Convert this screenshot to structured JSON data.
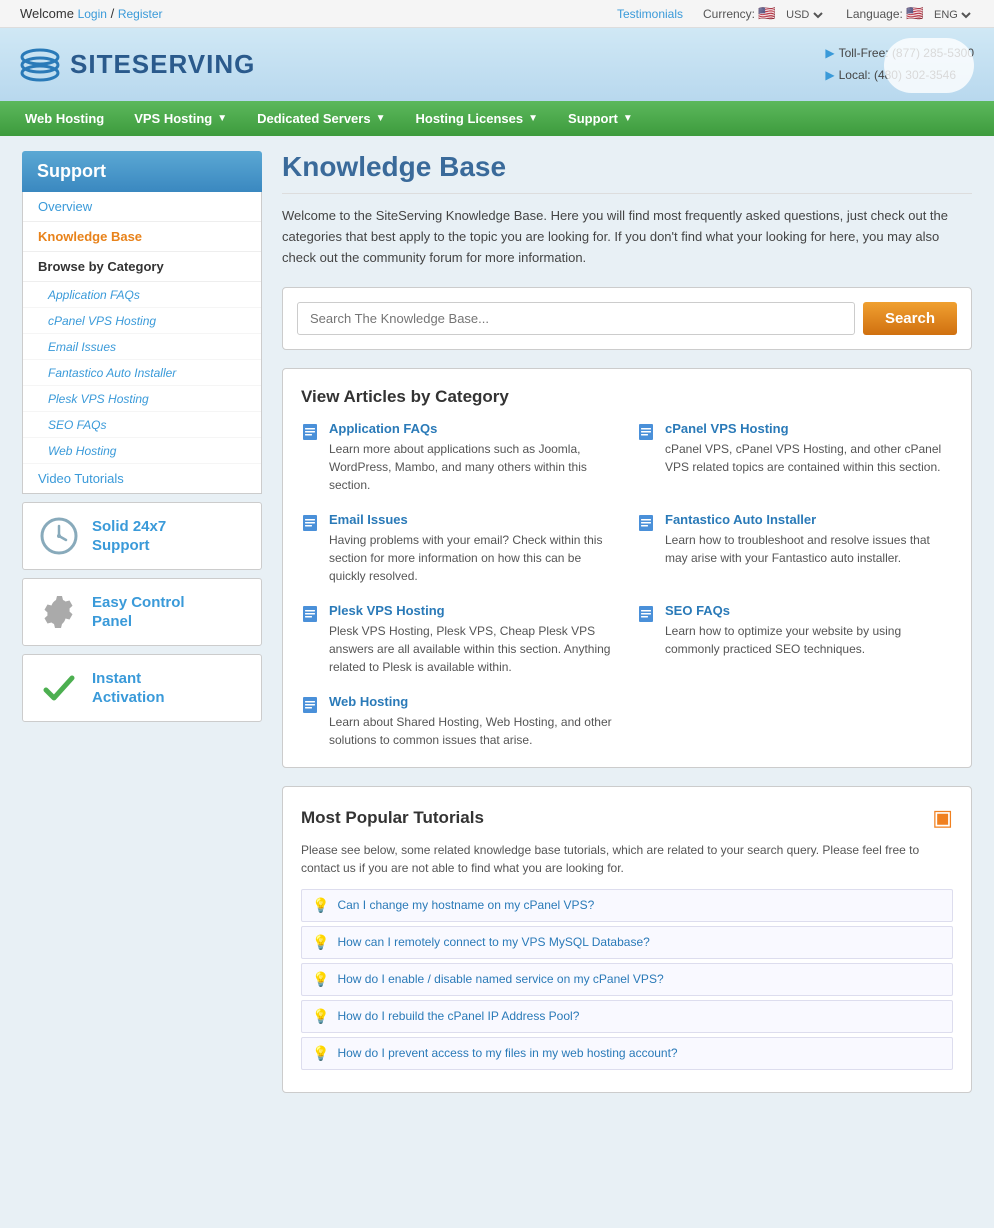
{
  "topbar": {
    "welcome_text": "Welcome",
    "login_label": "Login",
    "separator": " / ",
    "register_label": "Register",
    "testimonials_label": "Testimonials",
    "currency_label": "Currency:",
    "currency_value": "USD",
    "language_label": "Language:",
    "language_value": "ENG"
  },
  "header": {
    "logo_text": "SITESERVING",
    "toll_free_label": "Toll-Free: (877) 285-5300",
    "local_label": "Local: (480) 302-3546"
  },
  "nav": {
    "items": [
      {
        "label": "Web Hosting",
        "has_dropdown": false
      },
      {
        "label": "VPS Hosting",
        "has_dropdown": true
      },
      {
        "label": "Dedicated Servers",
        "has_dropdown": true
      },
      {
        "label": "Hosting Licenses",
        "has_dropdown": true
      },
      {
        "label": "Support",
        "has_dropdown": true
      }
    ]
  },
  "sidebar": {
    "support_header": "Support",
    "overview_label": "Overview",
    "knowledge_base_label": "Knowledge Base",
    "browse_category_label": "Browse by Category",
    "sub_items": [
      "Application FAQs",
      "cPanel VPS Hosting",
      "Email Issues",
      "Fantastico Auto Installer",
      "Plesk VPS Hosting",
      "SEO FAQs",
      "Web Hosting"
    ],
    "video_tutorials_label": "Video Tutorials"
  },
  "promo_boxes": [
    {
      "id": "solid-support",
      "text": "Solid 24x7\nSupport",
      "icon_type": "clock"
    },
    {
      "id": "easy-control",
      "text": "Easy Control\nPanel",
      "icon_type": "gear"
    },
    {
      "id": "instant-activation",
      "text": "Instant\nActivation",
      "icon_type": "check"
    }
  ],
  "content": {
    "page_title": "Knowledge Base",
    "intro_text": "Welcome to the SiteServing Knowledge Base. Here you will find most frequently asked questions, just check out the categories that best apply to the topic you are looking for. If you don't find what your looking for here, you may also check out the community forum for more information.",
    "search_placeholder": "Search The Knowledge Base...",
    "search_button_label": "Search",
    "view_articles_title": "View Articles by Category",
    "categories": [
      {
        "title": "Application FAQs",
        "desc": "Learn more about applications such as Joomla, WordPress, Mambo, and many others within this section."
      },
      {
        "title": "cPanel VPS Hosting",
        "desc": "cPanel VPS, cPanel VPS Hosting, and other cPanel VPS related topics are contained within this section."
      },
      {
        "title": "Email Issues",
        "desc": "Having problems with your email? Check within this section for more information on how this can be quickly resolved."
      },
      {
        "title": "Fantastico Auto Installer",
        "desc": "Learn how to troubleshoot and resolve issues that may arise with your Fantastico auto installer."
      },
      {
        "title": "Plesk VPS Hosting",
        "desc": "Plesk VPS Hosting, Plesk VPS, Cheap Plesk VPS answers are all available within this section. Anything related to Plesk is available within."
      },
      {
        "title": "SEO FAQs",
        "desc": "Learn how to optimize your website by using commonly practiced SEO techniques."
      },
      {
        "title": "Web Hosting",
        "desc": "Learn about Shared Hosting, Web Hosting, and other solutions to common issues that arise."
      }
    ],
    "popular_tutorials_title": "Most Popular Tutorials",
    "tutorials_intro": "Please see below, some related knowledge base tutorials, which are related to your search query. Please feel free to contact us if you are not able to find what you are looking for.",
    "tutorials": [
      "Can I change my hostname on my cPanel VPS?",
      "How can I remotely connect to my VPS MySQL Database?",
      "How do I enable / disable named service on my cPanel VPS?",
      "How do I rebuild the cPanel IP Address Pool?",
      "How do I prevent access to my files in my web hosting account?"
    ]
  }
}
